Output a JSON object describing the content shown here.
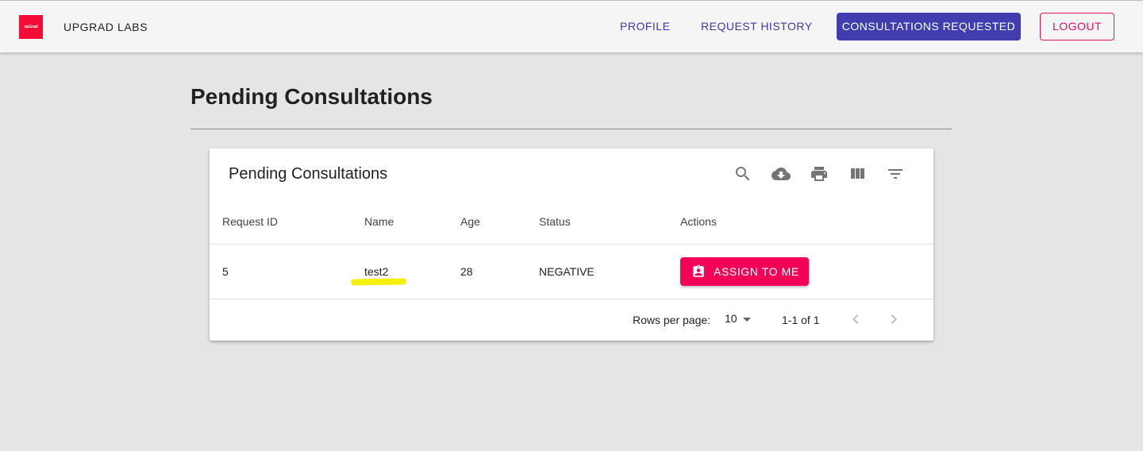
{
  "header": {
    "logo_text": "upGrad",
    "brand": "UPGRAD LABS",
    "nav": {
      "profile": "PROFILE",
      "history": "REQUEST HISTORY",
      "consultations": "CONSULTATIONS REQUESTED",
      "logout": "LOGOUT"
    }
  },
  "page": {
    "title": "Pending Consultations"
  },
  "table": {
    "title": "Pending Consultations",
    "toolbar_icons": [
      "search-icon",
      "cloud-download-icon",
      "print-icon",
      "view-columns-icon",
      "filter-icon"
    ],
    "columns": [
      "Request ID",
      "Name",
      "Age",
      "Status",
      "Actions"
    ],
    "rows": [
      {
        "request_id": "5",
        "name": "test2",
        "age": "28",
        "status": "NEGATIVE",
        "action": "ASSIGN TO ME"
      }
    ],
    "pagination": {
      "rows_per_page_label": "Rows per page:",
      "rows_per_page": "10",
      "range": "1-1 of 1"
    }
  },
  "colors": {
    "primary": "#3f3db0",
    "secondary": "#f50057",
    "highlight": "#f6f00b",
    "background": "#e5e5e5"
  }
}
